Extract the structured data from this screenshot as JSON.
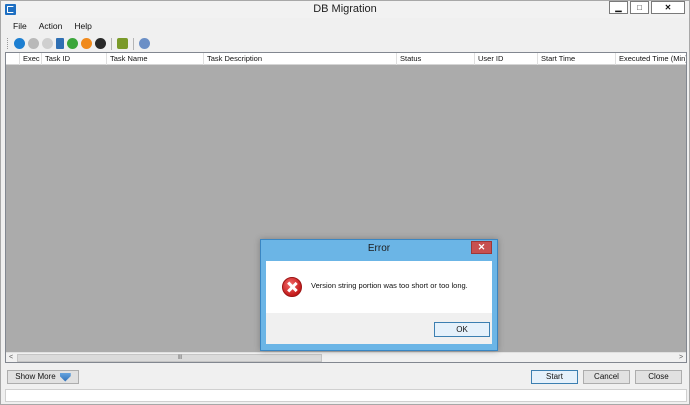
{
  "window": {
    "title": "DB Migration",
    "controls": {
      "minimize": "▁",
      "maximize": "□",
      "close": "✕"
    }
  },
  "menu": [
    "File",
    "Action",
    "Help"
  ],
  "toolbar": {
    "icons": [
      {
        "name": "run-icon",
        "color": "#1d7fd1"
      },
      {
        "name": "stop-icon",
        "color": "#b9b9b9"
      },
      {
        "name": "refresh-icon",
        "color": "#cfcfcf"
      },
      {
        "name": "document-icon",
        "color": "#2f6fb3"
      },
      {
        "name": "check-icon",
        "color": "#3ba63b"
      },
      {
        "name": "warning-icon",
        "color": "#f08a1c"
      },
      {
        "name": "info-icon",
        "color": "#2a2a2a"
      },
      {
        "name": "export-icon",
        "color": "#7a9a2a"
      },
      {
        "name": "settings-icon",
        "color": "#6b8fc6"
      }
    ]
  },
  "grid": {
    "columns": [
      "",
      "Exec",
      "Task ID",
      "Task Name",
      "Task Description",
      "Status",
      "User ID",
      "Start Time",
      "Executed Time (Min)"
    ],
    "scroll_grip": "III",
    "scroll_left": "<",
    "scroll_right": ">"
  },
  "buttons": {
    "show_more": "Show More",
    "start": "Start",
    "cancel": "Cancel",
    "close": "Close"
  },
  "dialog": {
    "title": "Error",
    "close": "✕",
    "message": "Version string portion was too short or too long.",
    "ok": "OK"
  }
}
